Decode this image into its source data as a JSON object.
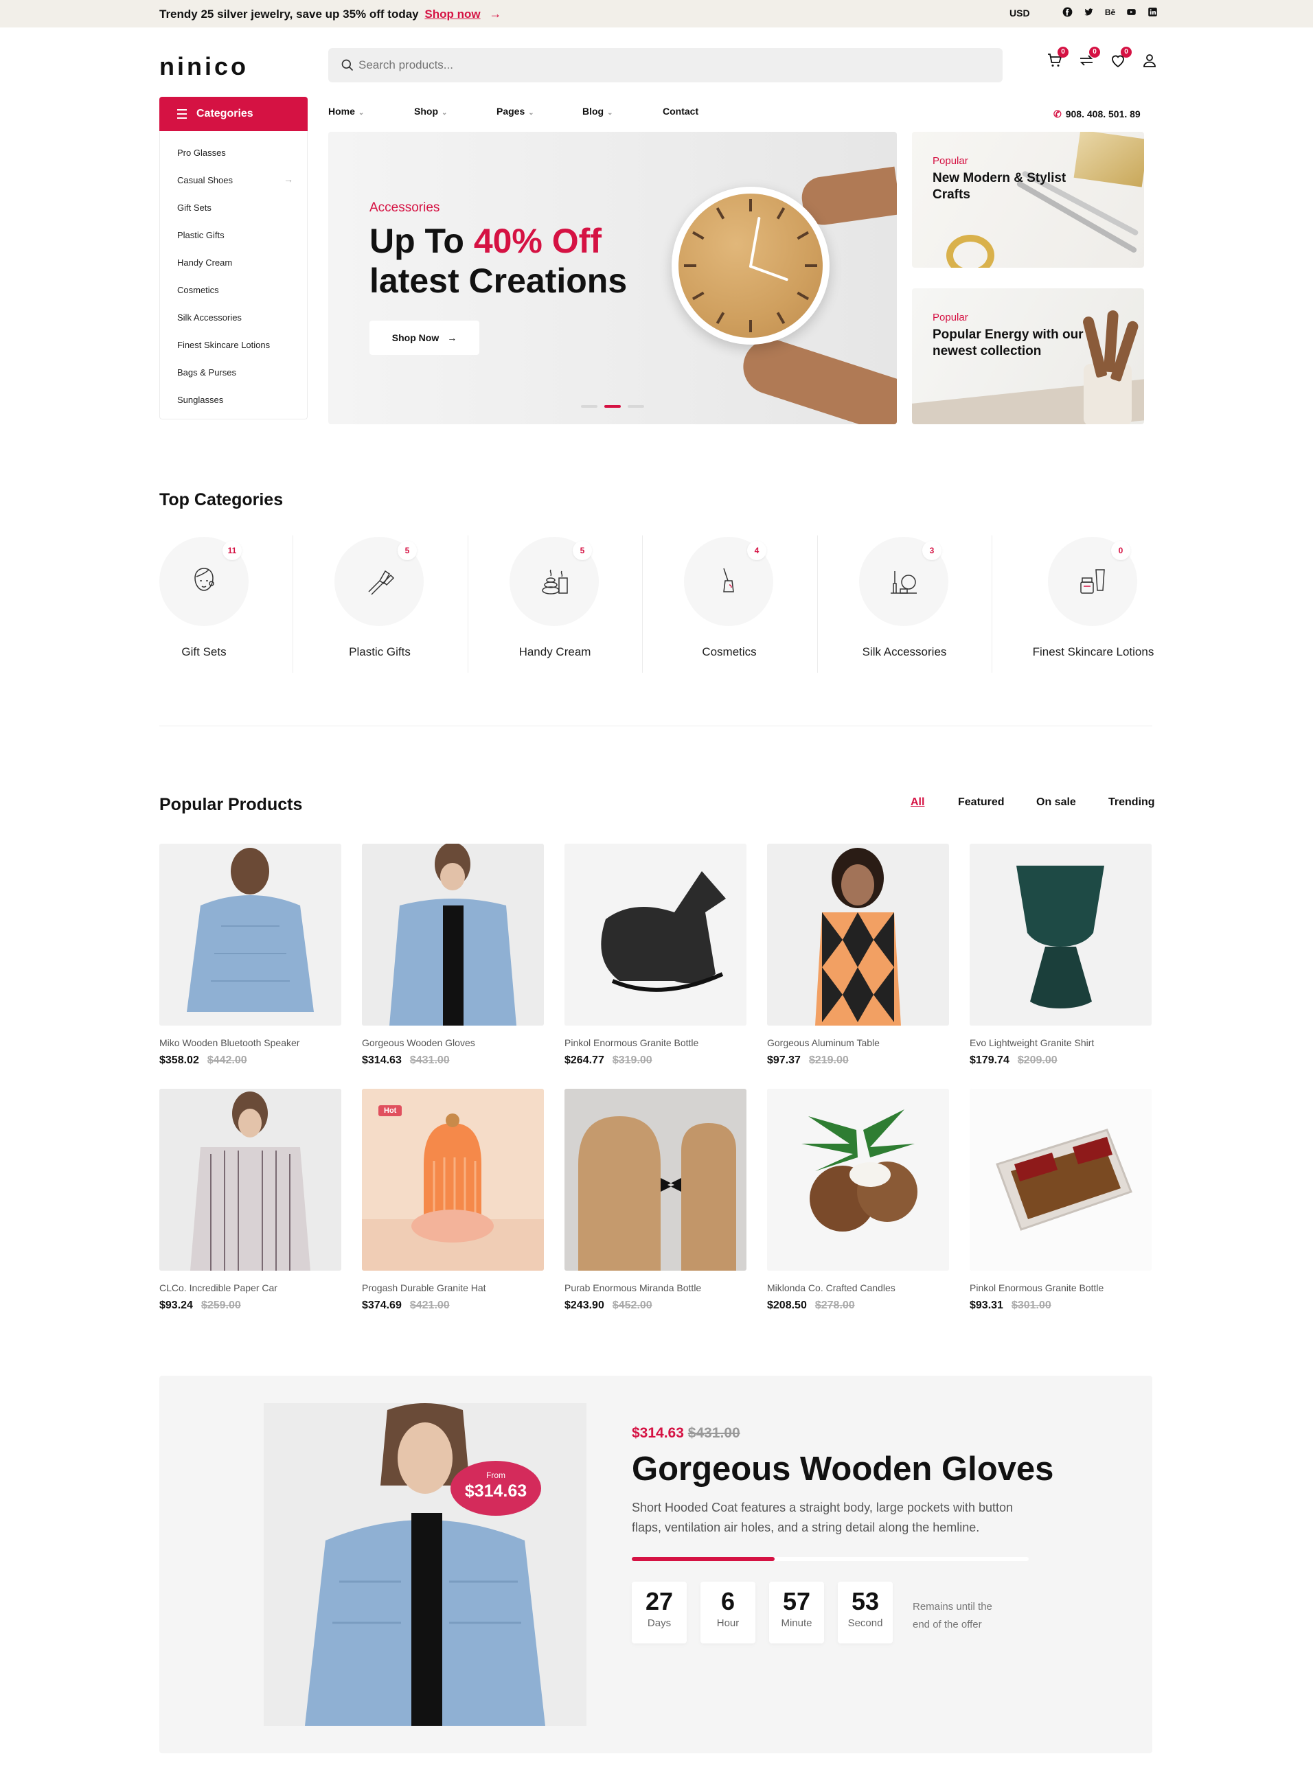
{
  "topbar": {
    "promo": "Trendy 25 silver jewelry, save up 35% off today",
    "shop_now": "Shop now",
    "currency": "USD",
    "social": [
      "facebook-icon",
      "twitter-icon",
      "behance-icon",
      "youtube-icon",
      "linkedin-icon"
    ],
    "behance_text": "Bē"
  },
  "header": {
    "logo": "ninico",
    "search_placeholder": "Search products...",
    "cart_count": "0",
    "compare_count": "0",
    "wishlist_count": "0"
  },
  "categories": {
    "title": "Categories",
    "items": [
      {
        "label": "Pro Glasses"
      },
      {
        "label": "Casual Shoes"
      },
      {
        "label": "Gift Sets"
      },
      {
        "label": "Plastic Gifts"
      },
      {
        "label": "Handy Cream"
      },
      {
        "label": "Cosmetics"
      },
      {
        "label": "Silk Accessories"
      },
      {
        "label": "Finest Skincare Lotions"
      },
      {
        "label": "Bags & Purses"
      },
      {
        "label": "Sunglasses"
      }
    ]
  },
  "nav": {
    "items": [
      "Home",
      "Shop",
      "Pages",
      "Blog",
      "Contact"
    ],
    "phone": "908. 408. 501. 89"
  },
  "hero": {
    "eyebrow": "Accessories",
    "title_pre": "Up To ",
    "title_highlight": "40% Off",
    "title_line2": "latest Creations",
    "button": "Shop Now",
    "active_slide": 2,
    "slides": 3
  },
  "side_banners": [
    {
      "eyebrow": "Popular",
      "title_1": "New Modern & Stylist",
      "title_2": "Crafts"
    },
    {
      "eyebrow": "Popular",
      "title_1": "Popular Energy with our",
      "title_2": "newest collection"
    }
  ],
  "top_categories": {
    "title": "Top Categories",
    "items": [
      {
        "name": "Gift Sets",
        "count": "11",
        "icon": "face-care-icon"
      },
      {
        "name": "Plastic Gifts",
        "count": "5",
        "icon": "brushes-icon"
      },
      {
        "name": "Handy Cream",
        "count": "5",
        "icon": "spa-stones-icon"
      },
      {
        "name": "Cosmetics",
        "count": "4",
        "icon": "nail-polish-icon"
      },
      {
        "name": "Silk Accessories",
        "count": "3",
        "icon": "mirror-makeup-icon"
      },
      {
        "name": "Finest Skincare Lotions",
        "count": "0",
        "icon": "cream-tube-icon"
      }
    ]
  },
  "products": {
    "title": "Popular Products",
    "tabs": [
      "All",
      "Featured",
      "On sale",
      "Trending"
    ],
    "active_tab": "All",
    "items": [
      {
        "name": "Miko Wooden Bluetooth Speaker",
        "price": "$358.02",
        "old": "$442.00"
      },
      {
        "name": "Gorgeous Wooden Gloves",
        "price": "$314.63",
        "old": "$431.00"
      },
      {
        "name": "Pinkol Enormous Granite Bottle",
        "price": "$264.77",
        "old": "$319.00"
      },
      {
        "name": "Gorgeous Aluminum Table",
        "price": "$97.37",
        "old": "$219.00"
      },
      {
        "name": "Evo Lightweight Granite Shirt",
        "price": "$179.74",
        "old": "$209.00"
      },
      {
        "name": "CLCo. Incredible Paper Car",
        "price": "$93.24",
        "old": "$259.00"
      },
      {
        "name": "Progash Durable Granite Hat",
        "price": "$374.69",
        "old": "$421.00",
        "badge": "Hot"
      },
      {
        "name": "Purab Enormous Miranda Bottle",
        "price": "$243.90",
        "old": "$452.00"
      },
      {
        "name": "Miklonda Co. Crafted Candles",
        "price": "$208.50",
        "old": "$278.00"
      },
      {
        "name": "Pinkol Enormous Granite Bottle",
        "price": "$93.31",
        "old": "$301.00"
      }
    ]
  },
  "deal": {
    "from_label": "From",
    "from_price": "$314.63",
    "price": "$314.63",
    "old_price": "$431.00",
    "title": "Gorgeous Wooden Gloves",
    "description": "Short Hooded Coat features a straight body, large pockets with button flaps, ventilation air holes, and a string detail along the hemline.",
    "progress": 0.36,
    "countdown": [
      {
        "value": "27",
        "unit": "Days"
      },
      {
        "value": "6",
        "unit": "Hour"
      },
      {
        "value": "57",
        "unit": "Minute"
      },
      {
        "value": "53",
        "unit": "Second"
      }
    ],
    "remains": "Remains until the end of the offer"
  },
  "colors": {
    "accent": "#d51243",
    "topbar": "#f2efe9"
  }
}
